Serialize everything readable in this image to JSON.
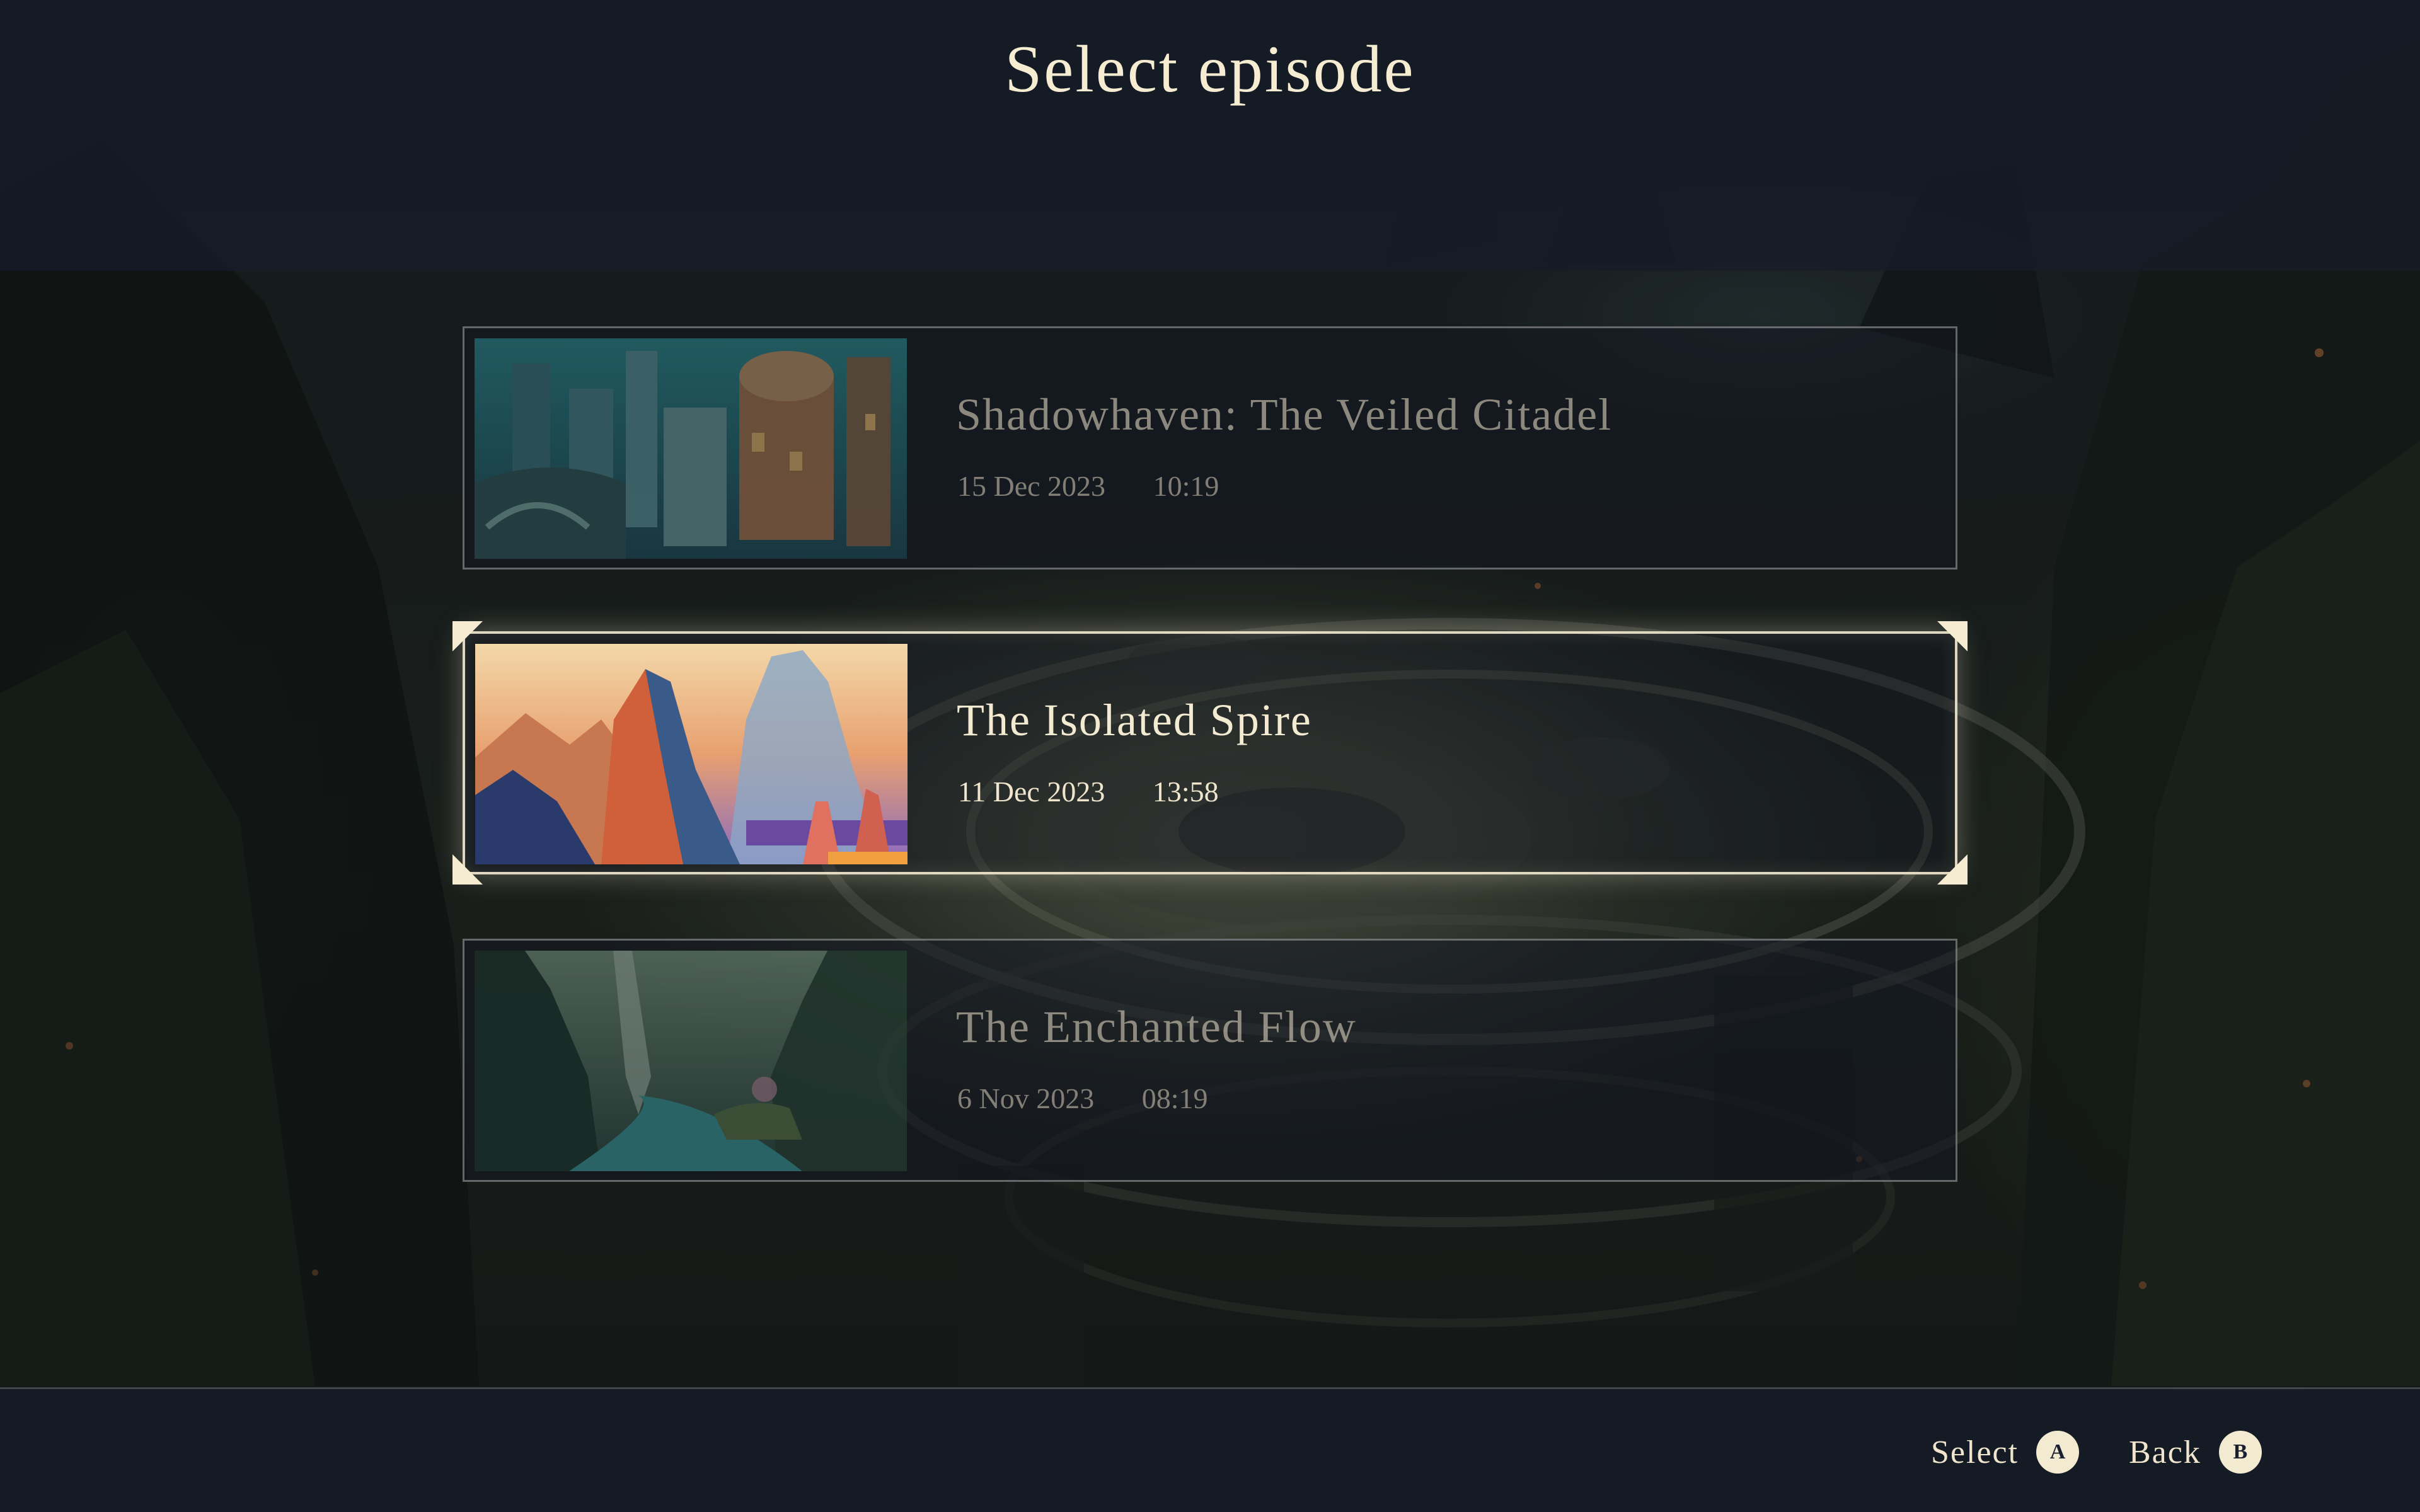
{
  "header": {
    "title": "Select episode"
  },
  "episodes": [
    {
      "title": "Shadowhaven: The Veiled Citadel",
      "date": "15 Dec 2023",
      "duration": "10:19",
      "thumbnail_icon": "citadel-city-thumbnail",
      "selected": false
    },
    {
      "title": "The Isolated Spire",
      "date": "11 Dec 2023",
      "duration": "13:58",
      "thumbnail_icon": "spire-mountain-thumbnail",
      "selected": true
    },
    {
      "title": "The Enchanted Flow",
      "date": "6 Nov 2023",
      "duration": "08:19",
      "thumbnail_icon": "river-forest-thumbnail",
      "selected": false
    }
  ],
  "footer": {
    "select": {
      "label": "Select",
      "button": "A"
    },
    "back": {
      "label": "Back",
      "button": "B"
    }
  },
  "colors": {
    "text": "#f3ead2",
    "panel": "#161c28",
    "selected_border": "#f5ecd2"
  }
}
